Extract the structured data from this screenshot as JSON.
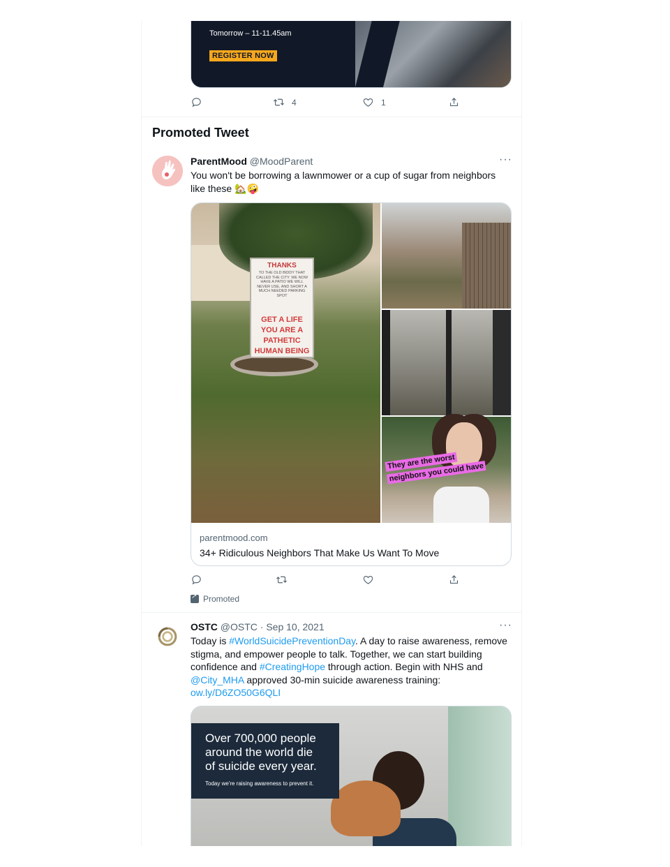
{
  "top_tweet": {
    "card": {
      "time": "Tomorrow – 11-11.45am",
      "cta": "REGISTER NOW"
    },
    "actions": {
      "reply_count": "",
      "retweet_count": "4",
      "like_count": "1"
    }
  },
  "section_title": "Promoted Tweet",
  "promoted_tweet": {
    "name": "ParentMood",
    "handle": "@MoodParent",
    "more": "···",
    "text": "You won't be borrowing a lawnmower or a cup of sugar from neighbors like these 🏡🤪",
    "image_text": {
      "sign_top": "THANKS",
      "sign_small": "TO THE OLD BIDDY THAT CALLED THE CITY. WE NOW HAVE A PATIO WE WILL NEVER USE, AND SHORT A MUCH NEEDED PARKING SPOT",
      "sign_bottom": "GET A LIFE YOU ARE A PATHETIC HUMAN BEING",
      "overlay_line1": "They are the worst",
      "overlay_line2": "neighbors you could have"
    },
    "card": {
      "domain": "parentmood.com",
      "title": "34+ Ridiculous Neighbors That Make Us Want To Move"
    },
    "promoted_label": "Promoted"
  },
  "ostc_tweet": {
    "name": "OSTC",
    "handle": "@OSTC",
    "date": "· Sep 10, 2021",
    "more": "···",
    "text_parts": {
      "p1": "Today is ",
      "h1": "#WorldSuicidePreventionDay",
      "p2": ". A day to raise awareness, remove stigma, and empower people to talk. Together, we can start building confidence and ",
      "h2": "#CreatingHope",
      "p3": " through action. Begin with NHS and ",
      "m1": "@City_MHA",
      "p4": " approved 30-min suicide awareness training: ",
      "l1": "ow.ly/D6ZO50G6QLI"
    },
    "image": {
      "headline": "Over 700,000 people around the world die of suicide every year.",
      "subline": "Today we're raising awareness to prevent it."
    }
  },
  "colors": {
    "link": "#1d9bf0",
    "secondary_text": "#536471",
    "border": "#cfd9de"
  }
}
